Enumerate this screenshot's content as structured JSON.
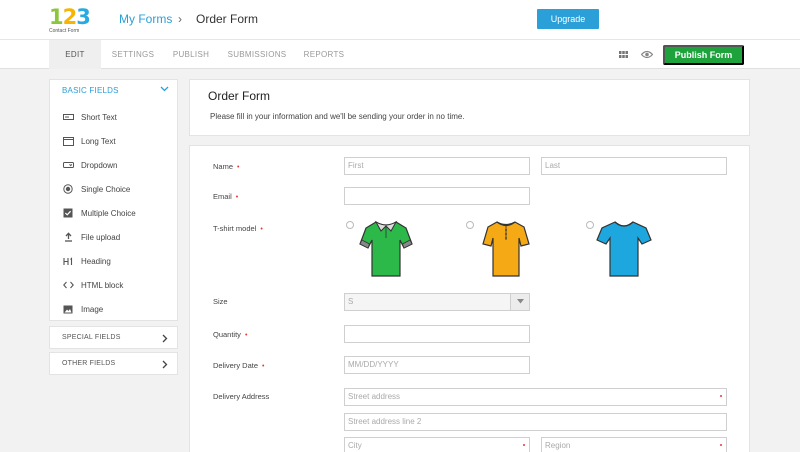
{
  "app": {
    "logo_digits": [
      "1",
      "2",
      "3"
    ],
    "logo_sub": "Contact Form",
    "breadcrumb_link": "My Forms",
    "breadcrumb_sep": "›",
    "breadcrumb_current": "Order Form",
    "upgrade_label": "Upgrade",
    "publish_label": "Publish Form"
  },
  "tabs": [
    {
      "label": "EDIT",
      "active": true
    },
    {
      "label": "SETTINGS"
    },
    {
      "label": "PUBLISH"
    },
    {
      "label": "SUBMISSIONS"
    },
    {
      "label": "REPORTS"
    }
  ],
  "sidebar": {
    "basic_label": "BASIC FIELDS",
    "items": [
      {
        "label": "Short Text",
        "icon": "short-text-icon"
      },
      {
        "label": "Long Text",
        "icon": "long-text-icon"
      },
      {
        "label": "Dropdown",
        "icon": "dropdown-icon"
      },
      {
        "label": "Single Choice",
        "icon": "radio-icon"
      },
      {
        "label": "Multiple Choice",
        "icon": "checkbox-icon"
      },
      {
        "label": "File upload",
        "icon": "upload-icon"
      },
      {
        "label": "Heading",
        "icon": "heading-icon"
      },
      {
        "label": "HTML block",
        "icon": "code-icon"
      },
      {
        "label": "Image",
        "icon": "image-icon"
      }
    ],
    "special_label": "SPECIAL FIELDS",
    "other_label": "OTHER FIELDS"
  },
  "form": {
    "title": "Order Form",
    "description": "Please fill in your information and we'll be sending your order in no time.",
    "required_mark": "•",
    "fields": {
      "name": {
        "label": "Name",
        "first_placeholder": "First",
        "last_placeholder": "Last"
      },
      "email": {
        "label": "Email"
      },
      "tshirt": {
        "label": "T-shirt model",
        "options": [
          {
            "color": "#2db84a",
            "icon": "green-polo-shirt-icon"
          },
          {
            "color": "#f5a915",
            "icon": "orange-henley-shirt-icon"
          },
          {
            "color": "#1ea7de",
            "icon": "blue-tshirt-icon"
          }
        ]
      },
      "size": {
        "label": "Size",
        "value": "S"
      },
      "quantity": {
        "label": "Quantity"
      },
      "delivery_date": {
        "label": "Delivery Date",
        "placeholder": "MM/DD/YYYY"
      },
      "delivery_address": {
        "label": "Delivery Address",
        "street_placeholder": "Street address",
        "street2_placeholder": "Street address line 2",
        "city_placeholder": "City",
        "region_placeholder": "Region"
      }
    }
  },
  "colors": {
    "accent": "#2a9fd8",
    "publish": "#1ea33c",
    "required": "#e53935"
  }
}
